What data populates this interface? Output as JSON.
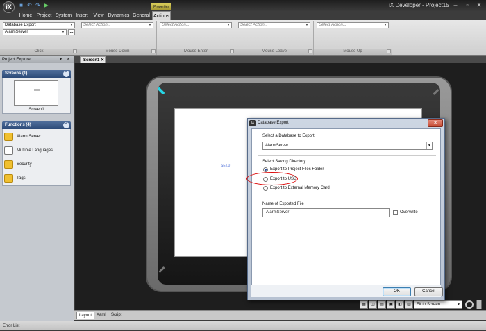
{
  "app": {
    "logo_text": "iX",
    "title": "iX Developer - Project15",
    "contextual_tab_label": "Properties",
    "window_controls": {
      "minimize": "–",
      "maximize": "▫",
      "close": "✕"
    }
  },
  "ribbon_tabs": [
    "Home",
    "Project",
    "System",
    "Insert",
    "View",
    "Dynamics",
    "General",
    "Actions"
  ],
  "active_tab": "Actions",
  "ribbon_groups": {
    "click": {
      "label": "Click",
      "action_value": "Database Export",
      "sub_value": "AlarmServer",
      "browse_label": "..."
    },
    "mouse_down": {
      "label": "Mouse Down",
      "placeholder": "Select Action..."
    },
    "mouse_enter": {
      "label": "Mouse Enter",
      "placeholder": "Select Action..."
    },
    "mouse_leave": {
      "label": "Mouse Leave",
      "placeholder": "Select Action..."
    },
    "mouse_up": {
      "label": "Mouse Up",
      "placeholder": "Select Action..."
    }
  },
  "project_explorer": {
    "title": "Project Explorer",
    "pin": "▾",
    "close": "✕",
    "screens_section": {
      "title": "Screens (1)",
      "items": [
        "Screen1"
      ]
    },
    "functions_section": {
      "title": "Functions (4)",
      "items": [
        "Alarm Server",
        "Multiple Languages",
        "Security",
        "Tags"
      ]
    }
  },
  "document_tab": {
    "label": "Screen1",
    "close": "✕"
  },
  "screen_value_label": "SET.0",
  "bottom_tabs": [
    "Layout",
    "Xaml",
    "Script"
  ],
  "active_bottom_tab": "Layout",
  "zoom": {
    "value": "Fit to Screen"
  },
  "status_bar": {
    "label": "Error List"
  },
  "dialog": {
    "title": "Database Export",
    "icon_text": "iX",
    "close": "✕",
    "select_db_label": "Select a Database to Export",
    "db_value": "AlarmServer",
    "saving_dir_label": "Select Saving Directory",
    "options": [
      "Export to Project Files Folder",
      "Export to USB",
      "Export to External Memory Card"
    ],
    "selected_option": "Export to Project Files Folder",
    "file_name_label": "Name of Exported File",
    "file_name_value": "AlarmServer",
    "overwrite_label": "Overwrite",
    "overwrite_checked": false,
    "ok_label": "OK",
    "cancel_label": "Cancel"
  },
  "annotation_color": "#dd1111"
}
